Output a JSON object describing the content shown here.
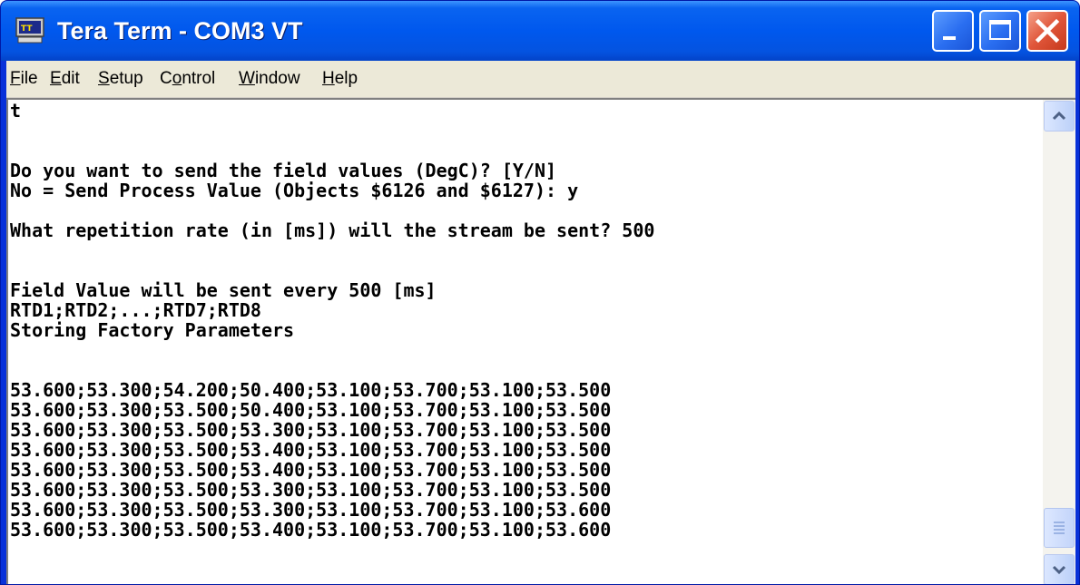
{
  "window": {
    "title": "Tera Term - COM3 VT",
    "icon": "terminal-app-icon",
    "controls": {
      "minimize_icon": "minimize-icon",
      "maximize_icon": "maximize-icon",
      "close_icon": "close-icon"
    },
    "colors": {
      "titlebar": "#0058ee",
      "close_button": "#e0563a"
    }
  },
  "menu": {
    "items": [
      {
        "label": "File",
        "mnemonic": "F"
      },
      {
        "label": "Edit",
        "mnemonic": "E"
      },
      {
        "label": "Setup",
        "mnemonic": "S"
      },
      {
        "label": "Control",
        "mnemonic": "o"
      },
      {
        "label": "Window",
        "mnemonic": "W"
      },
      {
        "label": "Help",
        "mnemonic": "H"
      }
    ]
  },
  "terminal": {
    "lines": [
      "t",
      "",
      "",
      "Do you want to send the field values (DegC)? [Y/N]",
      "No = Send Process Value (Objects $6126 and $6127): y",
      "",
      "What repetition rate (in [ms]) will the stream be sent? 500",
      "",
      "",
      "Field Value will be sent every 500 [ms]",
      "RTD1;RTD2;...;RTD7;RTD8",
      "Storing Factory Parameters",
      "",
      "",
      "53.600;53.300;54.200;50.400;53.100;53.700;53.100;53.500",
      "53.600;53.300;53.500;50.400;53.100;53.700;53.100;53.500",
      "53.600;53.300;53.500;53.300;53.100;53.700;53.100;53.500",
      "53.600;53.300;53.500;53.400;53.100;53.700;53.100;53.500",
      "53.600;53.300;53.500;53.400;53.100;53.700;53.100;53.500",
      "53.600;53.300;53.500;53.300;53.100;53.700;53.100;53.500",
      "53.600;53.300;53.500;53.300;53.100;53.700;53.100;53.600",
      "53.600;53.300;53.500;53.400;53.100;53.700;53.100;53.600"
    ]
  },
  "scrollbar": {
    "up_icon": "scroll-up-arrow-icon",
    "down_icon": "scroll-down-arrow-icon",
    "thumb_icon": "scroll-thumb-grip-icon"
  }
}
